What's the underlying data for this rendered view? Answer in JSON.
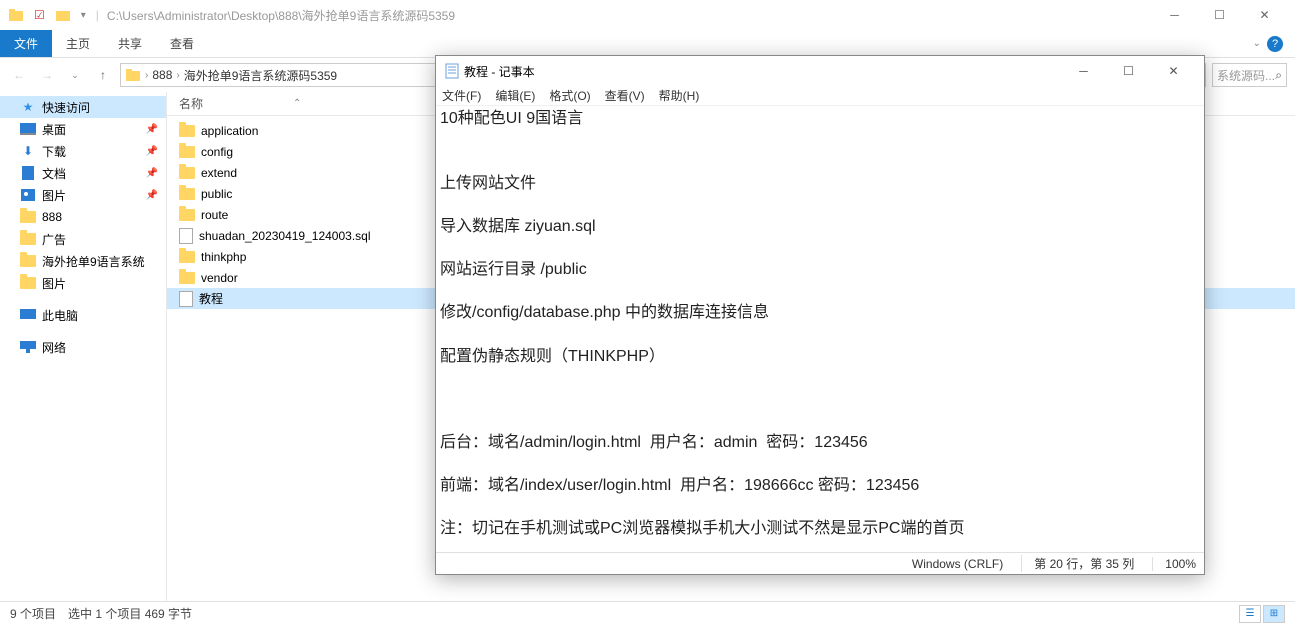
{
  "explorer": {
    "titlebar_path": "C:\\Users\\Administrator\\Desktop\\888\\海外抢单9语言系统源码5359",
    "ribbon": {
      "file": "文件",
      "home": "主页",
      "share": "共享",
      "view": "查看"
    },
    "breadcrumb": [
      "888",
      "海外抢单9语言系统源码5359"
    ],
    "search_placeholder": "系统源码...",
    "col_name": "名称",
    "sidebar": {
      "quick_access": "快速访问",
      "desktop": "桌面",
      "downloads": "下载",
      "documents": "文档",
      "pictures": "图片",
      "f888": "888",
      "ads": "广告",
      "overseas": "海外抢单9语言系统",
      "pictures2": "图片",
      "this_pc": "此电脑",
      "network": "网络"
    },
    "files": [
      {
        "name": "application",
        "type": "folder"
      },
      {
        "name": "config",
        "type": "folder"
      },
      {
        "name": "extend",
        "type": "folder"
      },
      {
        "name": "public",
        "type": "folder"
      },
      {
        "name": "route",
        "type": "folder"
      },
      {
        "name": "shuadan_20230419_124003.sql",
        "type": "sql"
      },
      {
        "name": "thinkphp",
        "type": "folder"
      },
      {
        "name": "vendor",
        "type": "folder"
      },
      {
        "name": "教程",
        "type": "txt",
        "selected": true
      }
    ],
    "status": {
      "count": "9 个项目",
      "selected": "选中 1 个项目  469 字节"
    }
  },
  "notepad": {
    "title": "教程 - 记事本",
    "menu": {
      "file": "文件(F)",
      "edit": "编辑(E)",
      "format": "格式(O)",
      "view": "查看(V)",
      "help": "帮助(H)"
    },
    "content": "10种配色UI 9国语言\n\n\n上传网站文件\n\n导入数据库 ziyuan.sql\n\n网站运行目录 /public\n\n修改/config/database.php 中的数据库连接信息\n\n配置伪静态规则（THINKPHP）\n\n\n\n后台：域名/admin/login.html  用户名：admin  密码：123456\n\n前端：域名/index/user/login.html  用户名：198666cc 密码：123456\n\n注：切记在手机测试或PC浏览器模拟手机大小测试不然是显示PC端的首页",
    "status": {
      "encoding": "Windows (CRLF)",
      "pos": "第 20 行，第 35 列",
      "zoom": "100%"
    }
  }
}
